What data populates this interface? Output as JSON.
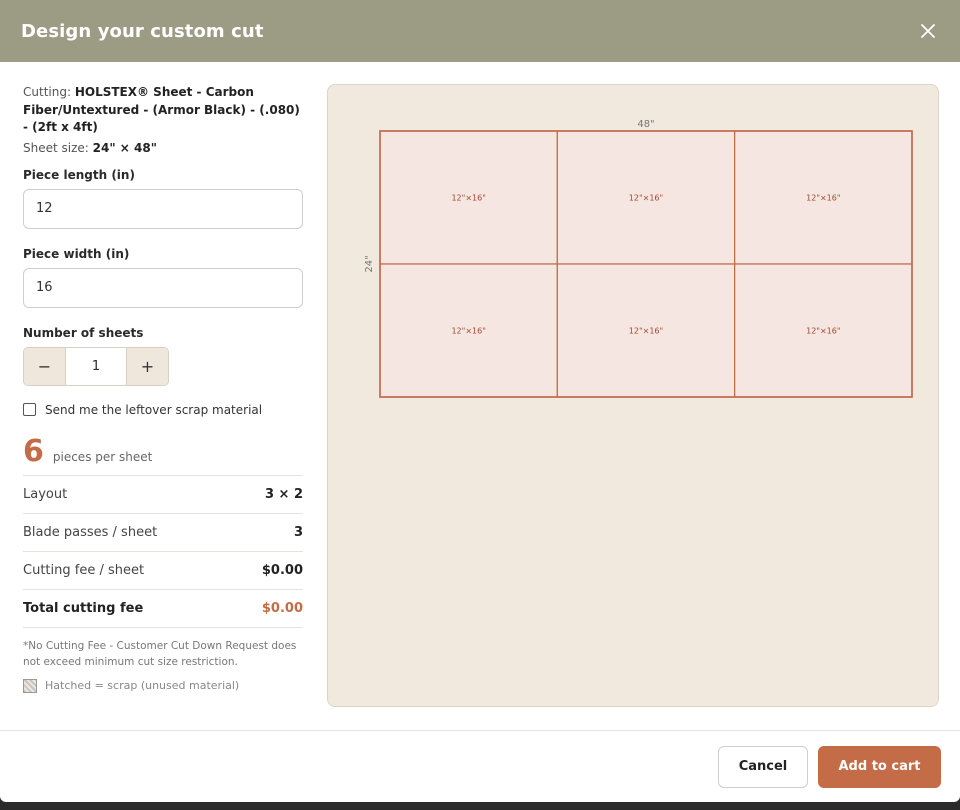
{
  "header": {
    "title": "Design your custom cut"
  },
  "info": {
    "cutting_label": "Cutting:",
    "cutting_value": "HOLSTEX® Sheet - Carbon Fiber/Untextured - (Armor Black) - (.080) - (2ft x 4ft)",
    "sheet_size_label": "Sheet size:",
    "sheet_size_value": "24\" × 48\""
  },
  "form": {
    "length_label": "Piece length (in)",
    "length_value": "12",
    "width_label": "Piece width (in)",
    "width_value": "16",
    "sheets_label": "Number of sheets",
    "sheets_value": "1",
    "minus": "−",
    "plus": "+",
    "scrap_label": "Send me the leftover scrap material",
    "scrap_checked": false
  },
  "summary": {
    "pieces_count": "6",
    "pieces_label": "pieces per sheet",
    "rows": [
      {
        "label": "Layout",
        "value": "3 × 2"
      },
      {
        "label": "Blade passes / sheet",
        "value": "3"
      },
      {
        "label": "Cutting fee / sheet",
        "value": "$0.00"
      },
      {
        "label": "Total cutting fee",
        "value": "$0.00"
      }
    ],
    "note": "*No Cutting Fee - Customer Cut Down Request does not exceed minimum cut size restriction.",
    "legend": "Hatched = scrap (unused material)"
  },
  "diagram": {
    "width_label": "48\"",
    "height_label": "24\"",
    "cols": 3,
    "rows": 2,
    "piece_label": "12\"×16\"",
    "cell_fill": "#f6e6e1",
    "line_color": "#c0694a"
  },
  "footer": {
    "cancel": "Cancel",
    "add": "Add to cart"
  },
  "colors": {
    "header_bg": "#9c9b83",
    "accent": "#c46b47",
    "preview_bg": "#f1e8de"
  }
}
